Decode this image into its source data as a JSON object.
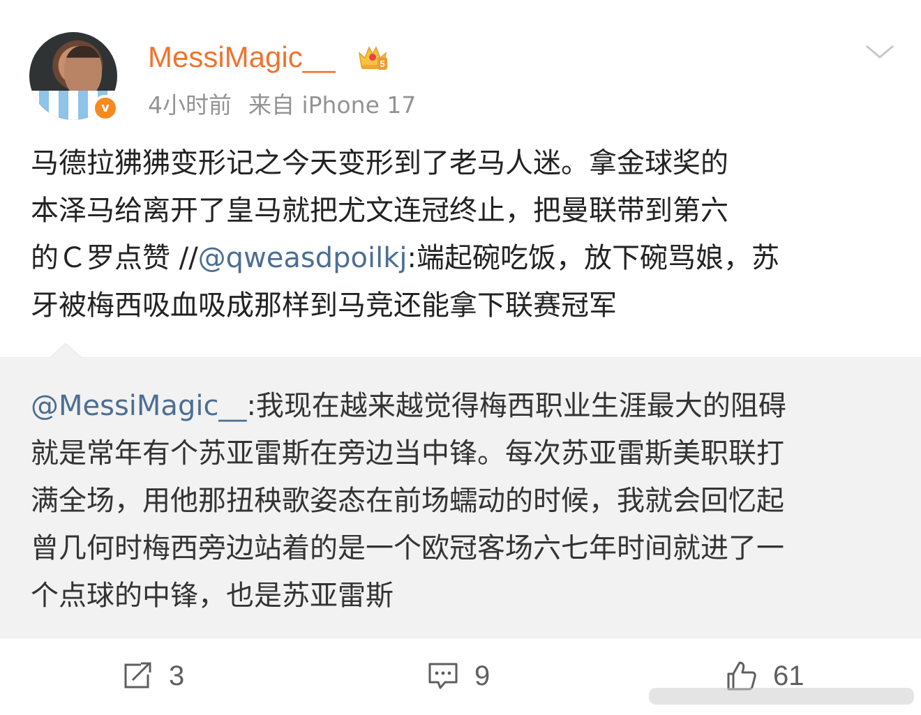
{
  "post": {
    "username": "MessiMagic__",
    "time": "4小时前",
    "source": "来自 iPhone 17",
    "verified_badge": "v",
    "crown_badge_number": "5",
    "text_lines": [
      "马德拉狒狒变形记之今天变形到了老马人迷。拿金球奖的",
      "本泽马给离开了皇马就把尤文连冠终止，把曼联带到第六",
      {
        "before": "的Ｃ罗点赞 //",
        "mention": "@qweasdpoilkj",
        "after": ":端起碗吃饭，放下碗骂娘，苏"
      },
      "牙被梅西吸血吸成那样到马竞还能拿下联赛冠军"
    ]
  },
  "quoted": {
    "text_lines": [
      {
        "mention": "@MessiMagic__",
        "after": ":我现在越来越觉得梅西职业生涯最大的阻碍"
      },
      "就是常年有个苏亚雷斯在旁边当中锋。每次苏亚雷斯美职联打",
      "满全场，用他那扭秧歌姿态在前场蠕动的时候，我就会回忆起",
      "曾几何时梅西旁边站着的是一个欧冠客场六七年时间就进了一",
      "个点球的中锋，也是苏亚雷斯"
    ]
  },
  "actions": {
    "repost_count": "3",
    "comment_count": "9",
    "like_count": "61"
  },
  "icons": {
    "repost": "repost-icon",
    "comment": "comment-icon",
    "like": "thumbs-up-icon",
    "menu": "chevron-down-icon",
    "crown": "crown-icon"
  },
  "colors": {
    "username": "#f0732e",
    "mention": "#4c6e93",
    "quoted_background": "#f2f2f2",
    "verified": "#f78a1e"
  }
}
